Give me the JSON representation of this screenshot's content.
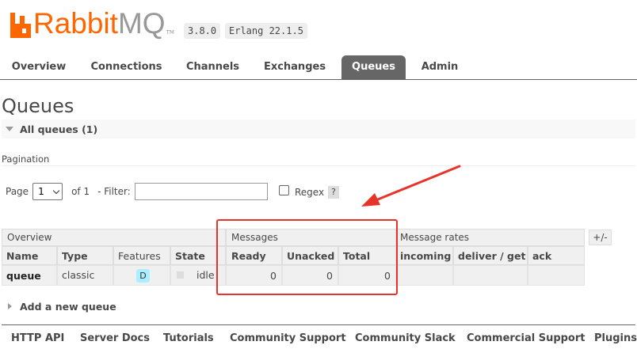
{
  "brand": {
    "name_main": "Rabbit",
    "name_accent": "MQ",
    "tm": "TM",
    "version": "3.8.0",
    "erlang": "Erlang 22.1.5"
  },
  "tabs": [
    {
      "label": "Overview",
      "active": false
    },
    {
      "label": "Connections",
      "active": false
    },
    {
      "label": "Channels",
      "active": false
    },
    {
      "label": "Exchanges",
      "active": false
    },
    {
      "label": "Queues",
      "active": true
    },
    {
      "label": "Admin",
      "active": false
    }
  ],
  "page_title": "Queues",
  "all_queues": "All queues (1)",
  "pagination": {
    "label": "Pagination",
    "page_label": "Page",
    "page_value": "1",
    "of_label": "of 1",
    "filter_label": "- Filter:",
    "filter_value": "",
    "regex_label": "Regex",
    "help": "?"
  },
  "table": {
    "groups": {
      "overview": "Overview",
      "messages": "Messages",
      "rates": "Message rates"
    },
    "plus_minus": "+/-",
    "headers": {
      "name": "Name",
      "type": "Type",
      "features": "Features",
      "state": "State",
      "ready": "Ready",
      "unacked": "Unacked",
      "total": "Total",
      "incoming": "incoming",
      "deliver": "deliver / get",
      "ack": "ack"
    },
    "rows": [
      {
        "name": "queue",
        "type": "classic",
        "feature": "D",
        "state": "idle",
        "ready": "0",
        "unacked": "0",
        "total": "0",
        "incoming": "",
        "deliver": "",
        "ack": ""
      }
    ]
  },
  "add_queue": "Add a new queue",
  "footer": [
    "HTTP API",
    "Server Docs",
    "Tutorials",
    "Community Support",
    "Community Slack",
    "Commercial Support",
    "Plugins"
  ],
  "colors": {
    "brand": "#ff6600",
    "annotation": "#e8332a",
    "feature_badge": "#aaeeff",
    "active_tab": "#666666"
  }
}
